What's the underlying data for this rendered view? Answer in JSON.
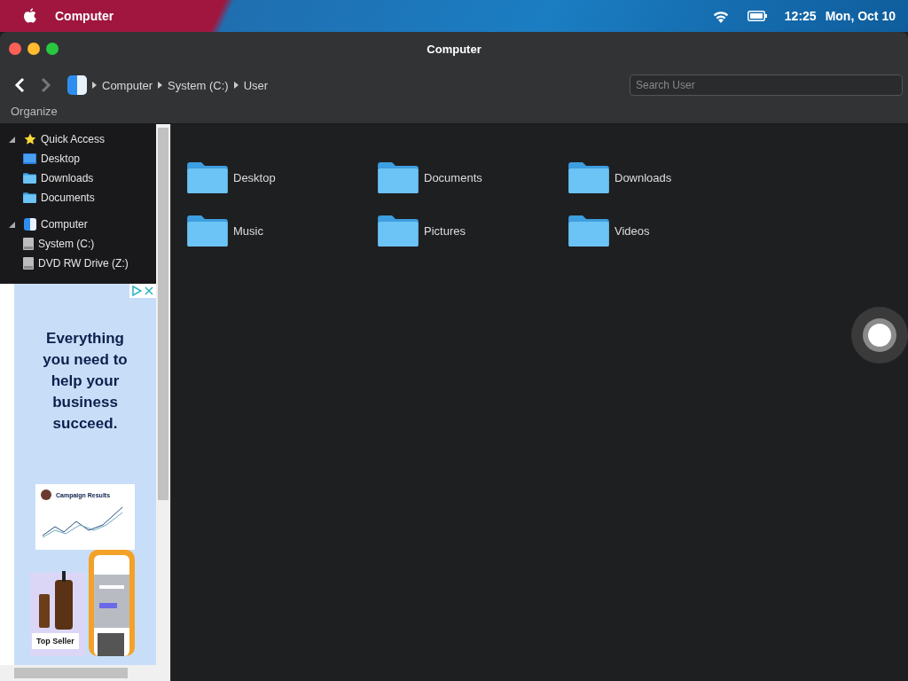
{
  "menubar": {
    "app_name": "Computer",
    "time": "12:25",
    "date": "Mon, Oct 10"
  },
  "window": {
    "title": "Computer"
  },
  "nav": {
    "back_disabled": false,
    "forward_disabled": true
  },
  "breadcrumb": [
    "Computer",
    "System (C:)",
    "User"
  ],
  "search": {
    "placeholder": "Search User"
  },
  "organize": "Organize",
  "sidebar": [
    {
      "label": "Quick Access",
      "kind": "star",
      "expanded": true,
      "children": [
        {
          "label": "Desktop",
          "kind": "desktop"
        },
        {
          "label": "Downloads",
          "kind": "folder"
        },
        {
          "label": "Documents",
          "kind": "folder"
        }
      ]
    },
    {
      "label": "Computer",
      "kind": "finder",
      "expanded": true,
      "children": [
        {
          "label": "System (C:)",
          "kind": "drive"
        },
        {
          "label": "DVD RW Drive (Z:)",
          "kind": "drive"
        }
      ]
    }
  ],
  "ad": {
    "headline": "Everything you need to help your business succeed.",
    "card_title": "Campaign Results",
    "badge": "Top Seller"
  },
  "folders": [
    {
      "name": "Desktop"
    },
    {
      "name": "Documents"
    },
    {
      "name": "Downloads"
    },
    {
      "name": "Music"
    },
    {
      "name": "Pictures"
    },
    {
      "name": "Videos"
    }
  ]
}
